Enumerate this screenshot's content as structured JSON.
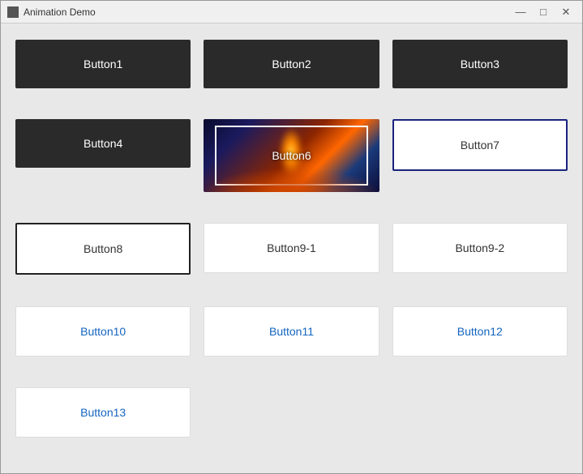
{
  "window": {
    "title": "Animation Demo",
    "icon": "app-icon"
  },
  "titlebar": {
    "minimize_label": "—",
    "maximize_label": "□",
    "close_label": "✕"
  },
  "buttons": {
    "btn1": {
      "label": "Button1",
      "style": "dark"
    },
    "btn2": {
      "label": "Button2",
      "style": "dark"
    },
    "btn3": {
      "label": "Button3",
      "style": "dark"
    },
    "btn4": {
      "label": "Button4",
      "style": "dark"
    },
    "btn6": {
      "label": "Button6",
      "style": "image"
    },
    "btn7": {
      "label": "Button7",
      "style": "outline-blue"
    },
    "btn8": {
      "label": "Button8",
      "style": "outline"
    },
    "btn9_1": {
      "label": "Button9-1",
      "style": "light"
    },
    "btn9_2": {
      "label": "Button9-2",
      "style": "light"
    },
    "btn10": {
      "label": "Button10",
      "style": "blue-text"
    },
    "btn11": {
      "label": "Button11",
      "style": "blue-text"
    },
    "btn12": {
      "label": "Button12",
      "style": "blue-text"
    },
    "btn13": {
      "label": "Button13",
      "style": "blue-text"
    }
  }
}
